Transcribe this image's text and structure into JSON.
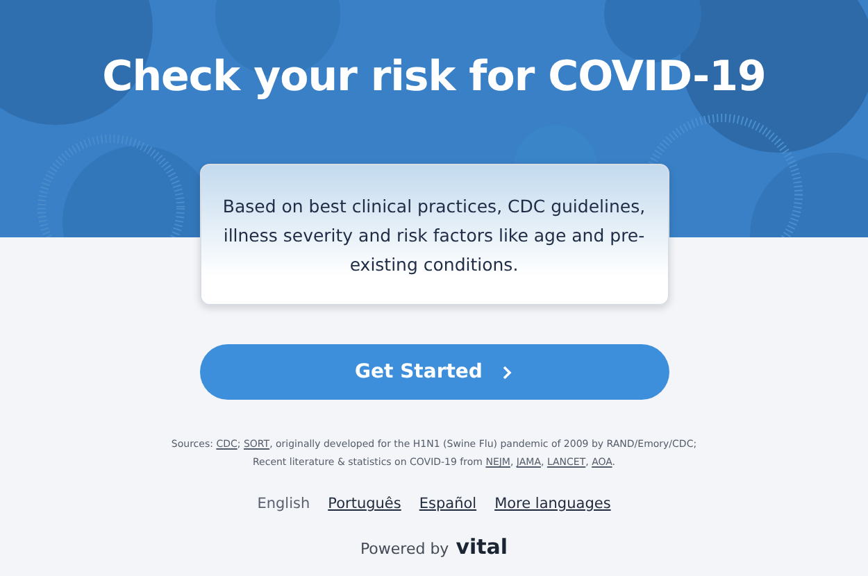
{
  "hero": {
    "title": "Check your risk for COVID-19"
  },
  "intro_card": {
    "text": "Based on best clinical practices, CDC guidelines, illness severity and risk factors like age and pre-existing conditions."
  },
  "cta_button": {
    "label": "Get Started"
  },
  "sources": [
    {
      "lead": "Sources: ",
      "links": [
        {
          "text": "CDC",
          "after": "; "
        },
        {
          "text": "SORT",
          "after": ", originally developed for the H1N1 (Swine Flu) pandemic of 2009 by RAND/Emory/CDC;"
        }
      ]
    },
    {
      "lead": "Recent literature & statistics on COVID-19 from ",
      "links": [
        {
          "text": "NEJM",
          "after": ", "
        },
        {
          "text": "JAMA",
          "after": ", "
        },
        {
          "text": "LANCET",
          "after": ", "
        },
        {
          "text": "AOA",
          "after": "."
        }
      ]
    }
  ],
  "languages": [
    {
      "label": "English",
      "selected": true
    },
    {
      "label": "Português",
      "selected": false
    },
    {
      "label": "Español",
      "selected": false
    },
    {
      "label": "More languages",
      "selected": false
    }
  ],
  "footer": {
    "powered_by": "Powered by",
    "brand": "vital"
  }
}
